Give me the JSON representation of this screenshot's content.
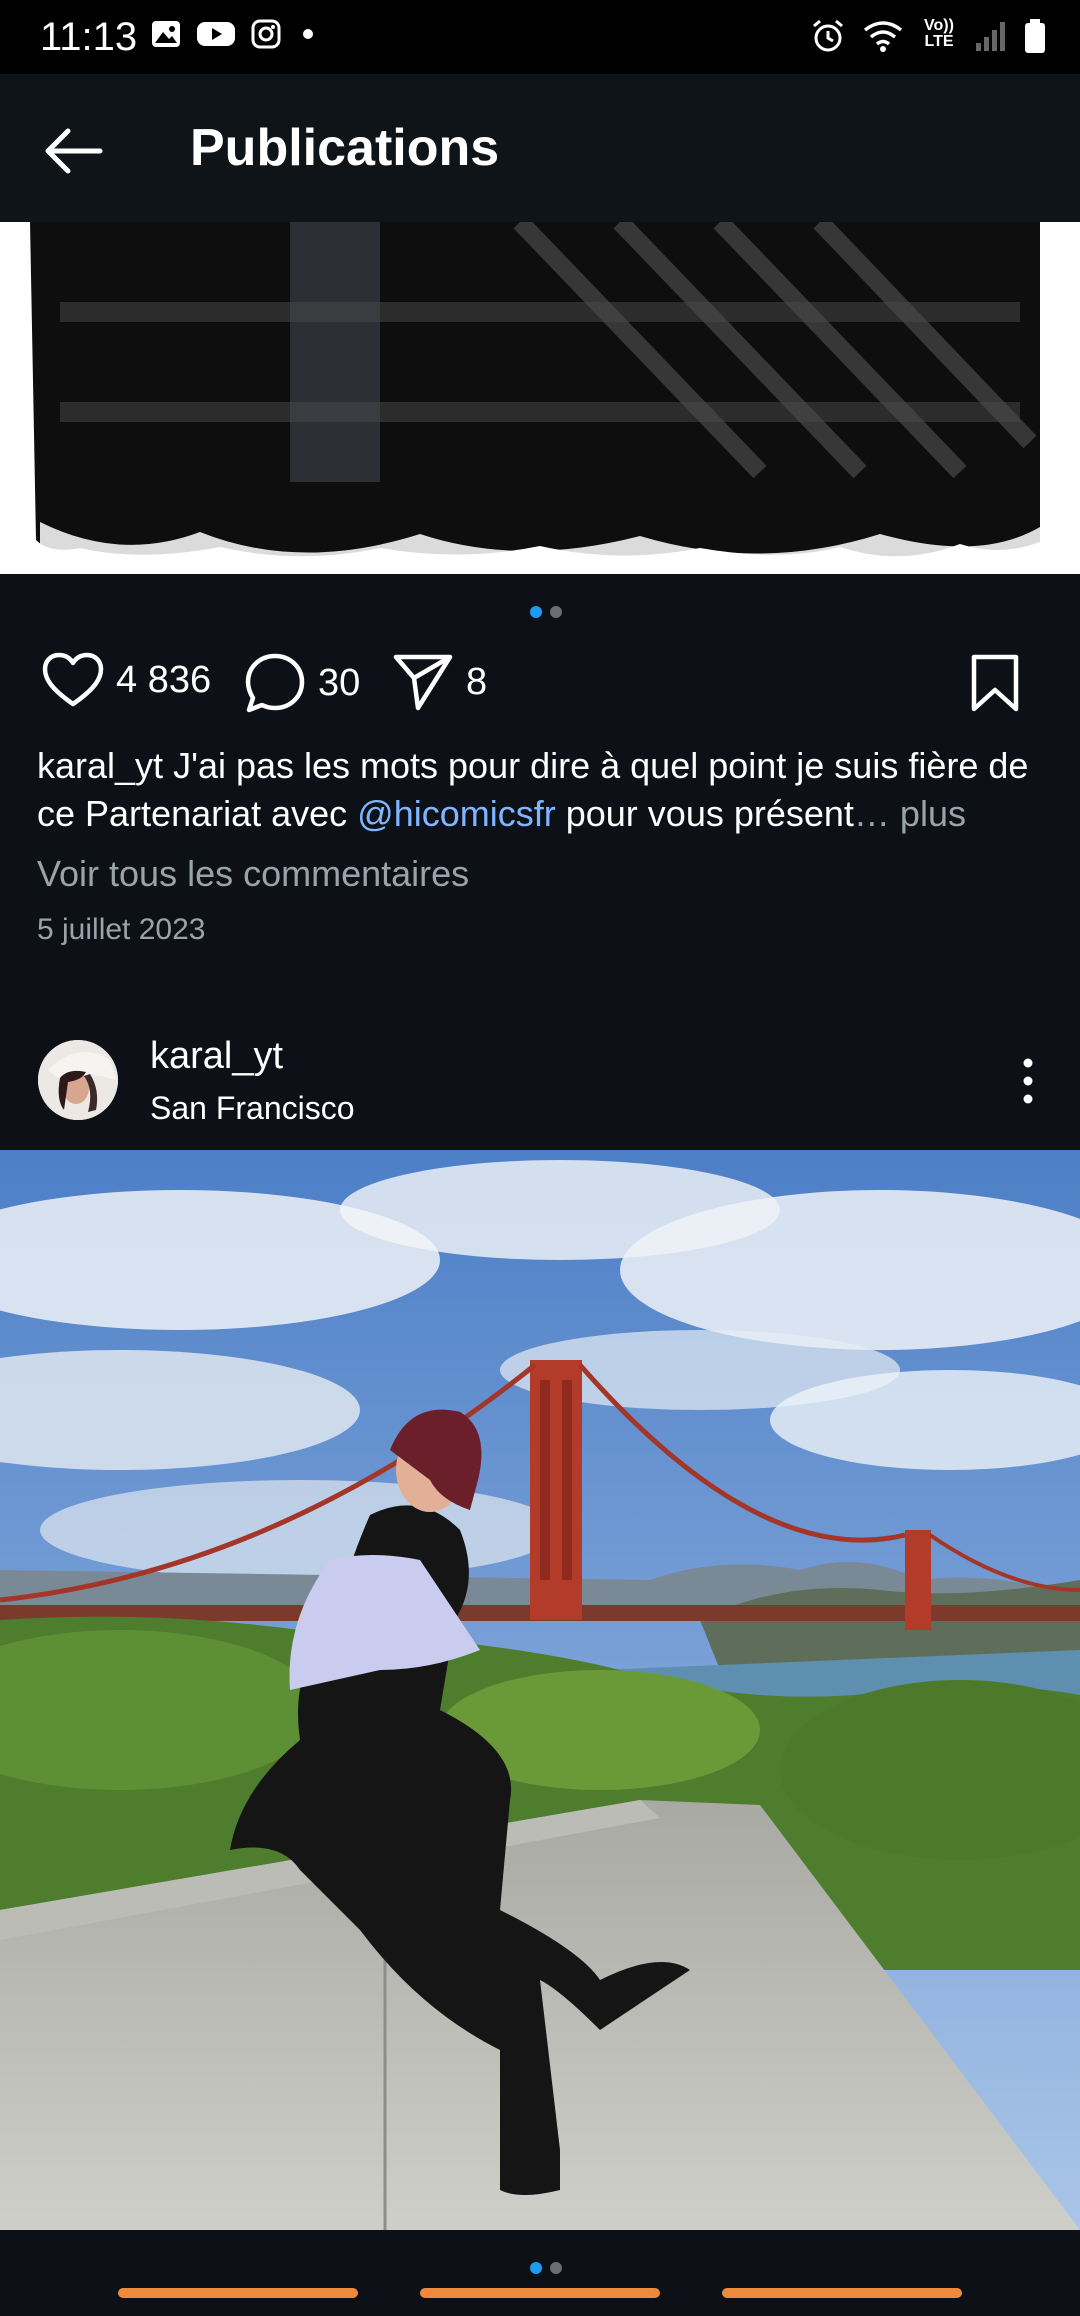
{
  "status_bar": {
    "time": "11:13",
    "icons": [
      "gallery-icon",
      "youtube-icon",
      "instagram-icon",
      "dot-icon",
      "alarm-icon",
      "wifi-icon",
      "volte-icon",
      "signal-icon",
      "battery-icon"
    ],
    "volte_label_top": "Vo))",
    "volte_label_bottom": "LTE"
  },
  "header": {
    "title": "Publications",
    "back_icon": "arrow-left-icon"
  },
  "post1": {
    "likes": "4 836",
    "comments": "30",
    "shares": "8",
    "caption_user": "karal_yt",
    "caption_text_1": " J'ai pas les mots pour dire à quel point je suis fière de ce Partenariat avec ",
    "mention": "@hicomicsfr",
    "caption_text_2": " pour vous présent",
    "more_label": "… plus",
    "view_comments": "Voir tous les commentaires",
    "date": "5 juillet 2023",
    "carousel_dots": 2,
    "carousel_active": 0
  },
  "post2": {
    "username": "karal_yt",
    "location": "San Francisco",
    "carousel_dots": 2,
    "carousel_active": 0
  },
  "colors": {
    "background": "#0d1117",
    "header": "#0f1419",
    "accent": "#1d9bf0",
    "mention": "#7fb6ff",
    "muted": "#9aa3ab",
    "bottom_bar": "#ef8a3c"
  }
}
